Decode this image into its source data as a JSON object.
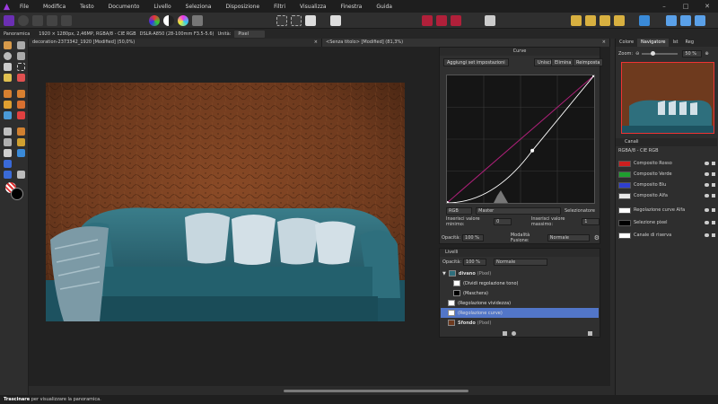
{
  "menu": {
    "items": [
      "File",
      "Modifica",
      "Testo",
      "Documento",
      "Livello",
      "Seleziona",
      "Disposizione",
      "Filtri",
      "Visualizza",
      "Finestra",
      "Guida"
    ],
    "window_controls": [
      "–",
      "□",
      "✕"
    ]
  },
  "context_bar": {
    "tool_name": "Panoramica",
    "doc_info": "1920 × 1280px, 2,46MP, RGBA/8 - CIE RGB",
    "camera_info": "DSLR-A850 (28-100mm F3.5-5.6)",
    "unit_label": "Unità:",
    "unit_value": "Pixel"
  },
  "doc_tabs": [
    {
      "label": "decoration-2373342_1920 [Modified] (50,0%)",
      "close": "×"
    },
    {
      "label": "<Senza titolo> [Modified] (81,3%)",
      "close": "×"
    }
  ],
  "curves": {
    "title": "Curve",
    "buttons": [
      "Aggiungi set impostazioni",
      "Unisci",
      "Elimina",
      "Reimposta"
    ],
    "color_space": "RGB",
    "channel": "Master",
    "picker_label": "Selezionatore",
    "min_label": "Inserisci valore minimo:",
    "min_value": "0",
    "max_label": "Inserisci valore massimo:",
    "max_value": "1",
    "opacity_label": "Opacità:",
    "opacity_value": "100 %",
    "blend_label": "Modalità Fusione:",
    "blend_value": "Normale",
    "curve_point": {
      "input": 0.58,
      "output": 0.41
    }
  },
  "layers": {
    "tab": "Livelli",
    "opacity_label": "Opacità:",
    "opacity_value": "100 %",
    "blend_value": "Normale",
    "items": [
      {
        "name": "divano",
        "tag": "(Pixel)"
      },
      {
        "name": "(Dividi regolazione tono)",
        "tag": ""
      },
      {
        "name": "(Maschera)",
        "tag": ""
      },
      {
        "name": "(Regolazione vividezza)",
        "tag": ""
      },
      {
        "name": "(Regolazione curve)",
        "tag": ""
      },
      {
        "name": "Sfondo",
        "tag": "(Pixel)"
      }
    ]
  },
  "right_panel": {
    "tabs": [
      "Colore",
      "Navigatore",
      "Ist",
      "Reg"
    ],
    "zoom_label": "Zoom:",
    "zoom_value": "50 %",
    "channels_tab": "Canali",
    "channels_space": "RGBA/8 - CIE RGB",
    "channels": [
      {
        "name": "Composito Rosso",
        "color": "#cc1f1f"
      },
      {
        "name": "Composito Verde",
        "color": "#1f9f2f"
      },
      {
        "name": "Composito Blu",
        "color": "#2f3fcf"
      },
      {
        "name": "Composito Alfa",
        "color": "#e8e8e8"
      },
      {
        "name": "Regolazione curve Alfa",
        "color": "#ffffff"
      },
      {
        "name": "Selezione pixel",
        "color": "#000000"
      },
      {
        "name": "Canale di riserva",
        "color": "#ffffff"
      }
    ]
  },
  "status": {
    "bold": "Trascinare",
    "text": " per visualizzare la panoramica."
  },
  "colors": {
    "accent": "#4a90d9",
    "selected_row": "#5276c8",
    "curve_line": "#ffffff",
    "diagonal": "#b0207a"
  }
}
